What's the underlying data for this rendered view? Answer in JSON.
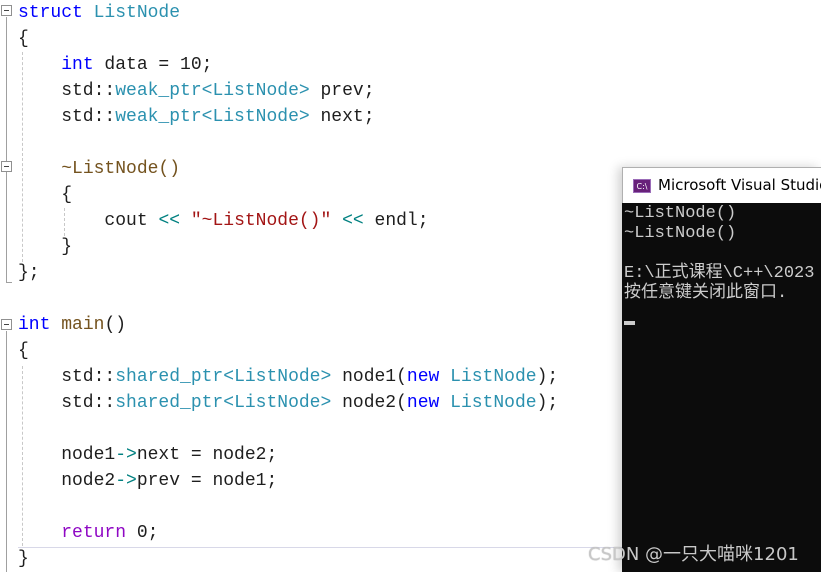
{
  "editor": {
    "lines": [
      {
        "parts": [
          [
            "kw",
            "struct"
          ],
          [
            "",
            " "
          ],
          [
            "type",
            "ListNode"
          ]
        ]
      },
      {
        "parts": [
          [
            "",
            "{"
          ]
        ]
      },
      {
        "parts": [
          [
            "",
            "    "
          ],
          [
            "kw",
            "int"
          ],
          [
            "",
            " data = 10;"
          ]
        ]
      },
      {
        "parts": [
          [
            "",
            "    std::"
          ],
          [
            "type",
            "weak_ptr"
          ],
          [
            "type",
            "<"
          ],
          [
            "type",
            "ListNode"
          ],
          [
            "type",
            ">"
          ],
          [
            "",
            " prev;"
          ]
        ]
      },
      {
        "parts": [
          [
            "",
            "    std::"
          ],
          [
            "type",
            "weak_ptr"
          ],
          [
            "type",
            "<"
          ],
          [
            "type",
            "ListNode"
          ],
          [
            "type",
            ">"
          ],
          [
            "",
            " next;"
          ]
        ]
      },
      {
        "parts": [
          [
            "",
            ""
          ]
        ]
      },
      {
        "parts": [
          [
            "",
            "    "
          ],
          [
            "fn",
            "~ListNode()"
          ]
        ]
      },
      {
        "parts": [
          [
            "",
            "    {"
          ]
        ]
      },
      {
        "parts": [
          [
            "",
            "        cout "
          ],
          [
            "op",
            "<<"
          ],
          [
            "",
            " "
          ],
          [
            "str",
            "\"~ListNode()\""
          ],
          [
            "",
            " "
          ],
          [
            "op",
            "<<"
          ],
          [
            "",
            " endl;"
          ]
        ]
      },
      {
        "parts": [
          [
            "",
            "    }"
          ]
        ]
      },
      {
        "parts": [
          [
            "",
            "};"
          ]
        ]
      },
      {
        "parts": [
          [
            "",
            ""
          ]
        ]
      },
      {
        "parts": [
          [
            "kw",
            "int"
          ],
          [
            "",
            " "
          ],
          [
            "fn",
            "main"
          ],
          [
            "",
            "()"
          ]
        ]
      },
      {
        "parts": [
          [
            "",
            "{"
          ]
        ]
      },
      {
        "parts": [
          [
            "",
            "    std::"
          ],
          [
            "type",
            "shared_ptr"
          ],
          [
            "type",
            "<"
          ],
          [
            "type",
            "ListNode"
          ],
          [
            "type",
            ">"
          ],
          [
            "",
            " node1("
          ],
          [
            "kw",
            "new"
          ],
          [
            "",
            " "
          ],
          [
            "type",
            "ListNode"
          ],
          [
            "",
            ");"
          ]
        ]
      },
      {
        "parts": [
          [
            "",
            "    std::"
          ],
          [
            "type",
            "shared_ptr"
          ],
          [
            "type",
            "<"
          ],
          [
            "type",
            "ListNode"
          ],
          [
            "type",
            ">"
          ],
          [
            "",
            " node2("
          ],
          [
            "kw",
            "new"
          ],
          [
            "",
            " "
          ],
          [
            "type",
            "ListNode"
          ],
          [
            "",
            ");"
          ]
        ]
      },
      {
        "parts": [
          [
            "",
            ""
          ]
        ]
      },
      {
        "parts": [
          [
            "",
            "    node1"
          ],
          [
            "op",
            "->"
          ],
          [
            "",
            "next = node2;"
          ]
        ]
      },
      {
        "parts": [
          [
            "",
            "    node2"
          ],
          [
            "op",
            "->"
          ],
          [
            "",
            "prev = node1;"
          ]
        ]
      },
      {
        "parts": [
          [
            "",
            ""
          ]
        ]
      },
      {
        "parts": [
          [
            "",
            "    "
          ],
          [
            "kw2",
            "return"
          ],
          [
            "",
            " 0;"
          ]
        ]
      },
      {
        "parts": [
          [
            "",
            "}"
          ]
        ]
      }
    ]
  },
  "console": {
    "icon_label": "C:\\",
    "title": "Microsoft Visual Studio",
    "output_lines": [
      "~ListNode()",
      "~ListNode()",
      "",
      "E:\\正式课程\\C++\\2023",
      "按任意键关闭此窗口. "
    ]
  },
  "watermark": "CSDN @一只大喵咪1201"
}
